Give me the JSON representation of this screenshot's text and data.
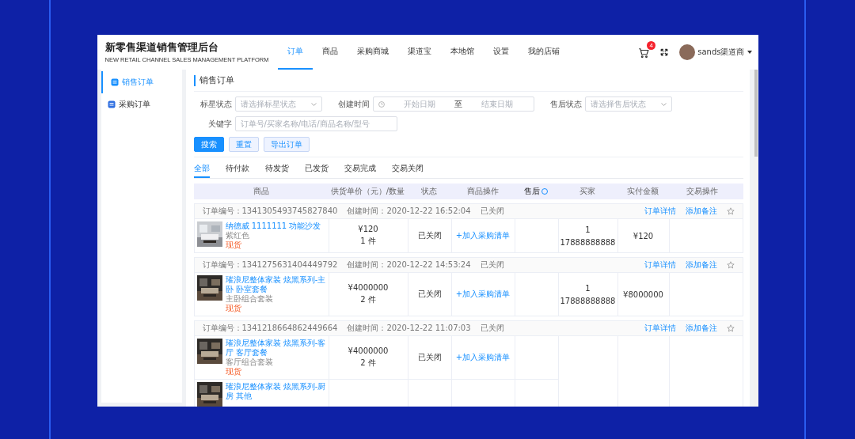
{
  "brand": {
    "title": "新零售渠道销售管理后台",
    "subtitle": "NEW RETAIL CHANNEL SALES MANAGEMENT PLATFORM"
  },
  "nav": [
    {
      "label": "订单",
      "selected": true
    },
    {
      "label": "商品",
      "selected": false
    },
    {
      "label": "采购商城",
      "selected": false
    },
    {
      "label": "渠道宝",
      "selected": false
    },
    {
      "label": "本地馆",
      "selected": false
    },
    {
      "label": "设置",
      "selected": false
    },
    {
      "label": "我的店铺",
      "selected": false
    }
  ],
  "cart_badge": "4",
  "user": "sands渠道商",
  "sidebar": [
    {
      "label": "销售订单",
      "selected": true
    },
    {
      "label": "采购订单",
      "selected": false
    }
  ],
  "page_title": "销售订单",
  "filters": [
    [
      {
        "kind": "select",
        "label": "标星状态",
        "placeholder": "请选择标星状态"
      },
      {
        "kind": "daterange",
        "label": "创建时间",
        "start_placeholder": "开始日期",
        "separator": "至",
        "end_placeholder": "结束日期"
      },
      {
        "kind": "select",
        "label": "售后状态",
        "placeholder": "请选择售后状态"
      }
    ],
    [
      {
        "kind": "text",
        "label": "关键字",
        "placeholder": "订单号/买家名称/电话/商品名称/型号"
      }
    ]
  ],
  "buttons": [
    {
      "label": "搜索",
      "kind": "primary"
    },
    {
      "label": "重置",
      "kind": "plain"
    },
    {
      "label": "导出订单",
      "kind": "plain"
    }
  ],
  "status_tabs": [
    {
      "label": "全部",
      "selected": true
    },
    {
      "label": "待付款",
      "selected": false
    },
    {
      "label": "待发货",
      "selected": false
    },
    {
      "label": "已发货",
      "selected": false
    },
    {
      "label": "交易完成",
      "selected": false
    },
    {
      "label": "交易关闭",
      "selected": false
    }
  ],
  "columns": [
    {
      "label": "商品",
      "kind": "plain"
    },
    {
      "label": "供货单价（元）/数量",
      "kind": "plain"
    },
    {
      "label": "状态",
      "kind": "plain"
    },
    {
      "label": "商品操作",
      "kind": "plain"
    },
    {
      "label": "售后",
      "kind": "help"
    },
    {
      "label": "买家",
      "kind": "plain"
    },
    {
      "label": "实付金额",
      "kind": "plain"
    },
    {
      "label": "交易操作",
      "kind": "plain"
    }
  ],
  "orders": [
    {
      "number_label": "订单编号：",
      "number": "1341305493745827840",
      "time_label": "创建时间：",
      "time": "2020-12-22 16:52:04",
      "status": "已关闭",
      "actions": [
        "订单详情",
        "添加备注"
      ],
      "starred": false,
      "buyer": {
        "count": "1",
        "phone": "17888888888"
      },
      "amount": "¥120",
      "items": [
        {
          "title": "纳德威 1111111 功能沙发",
          "spec": "紫红色",
          "stock": "现货",
          "price": "¥120",
          "quantity": "1 件",
          "status": "已关闭",
          "action": "+加入采购清单"
        }
      ]
    },
    {
      "number_label": "订单编号：",
      "number": "1341275631404449792",
      "time_label": "创建时间：",
      "time": "2020-12-22 14:53:24",
      "status": "已关闭",
      "actions": [
        "订单详情",
        "添加备注"
      ],
      "starred": false,
      "buyer": {
        "count": "1",
        "phone": "17888888888"
      },
      "amount": "¥8000000",
      "items": [
        {
          "title": "璀浪尼整体家装 炫黑系列-主卧 卧室套餐",
          "spec": "主卧组合套装",
          "stock": "现货",
          "price": "¥4000000",
          "quantity": "2 件",
          "status": "已关闭",
          "action": "+加入采购清单"
        }
      ]
    },
    {
      "number_label": "订单编号：",
      "number": "1341218664862449664",
      "time_label": "创建时间：",
      "time": "2020-12-22 11:07:03",
      "status": "已关闭",
      "actions": [
        "订单详情",
        "添加备注"
      ],
      "starred": false,
      "items": [
        {
          "title": "璀浪尼整体家装 炫黑系列-客厅 客厅套餐",
          "spec": "客厅组合套装",
          "stock": "现货",
          "price": "¥4000000",
          "quantity": "2 件",
          "status": "已关闭",
          "action": "+加入采购清单"
        },
        {
          "title": "璀浪尼整体家装 炫黑系列-厨房 其他"
        }
      ]
    }
  ]
}
